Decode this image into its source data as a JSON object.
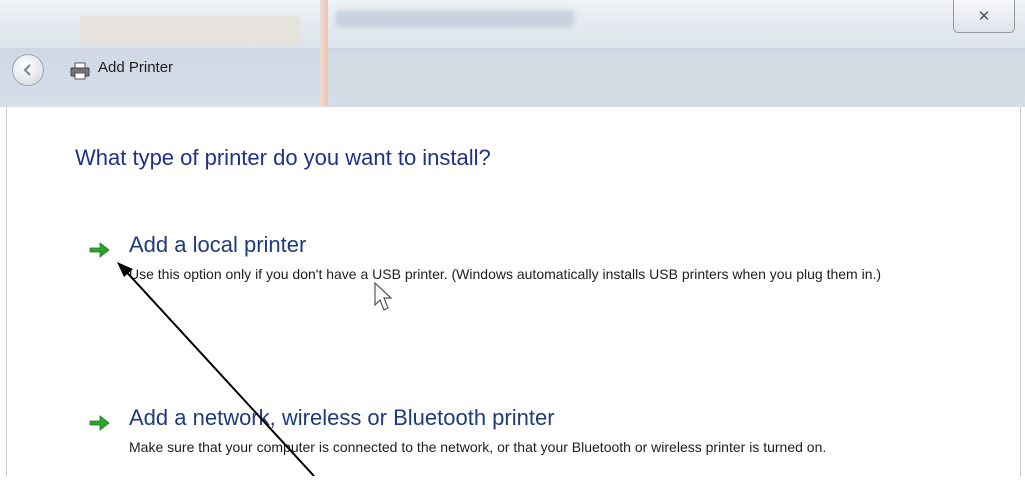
{
  "window": {
    "title": "Add Printer",
    "close_glyph": "✕"
  },
  "page": {
    "heading": "What type of printer do you want to install?"
  },
  "options": [
    {
      "title": "Add a local printer",
      "description": "Use this option only if you don't have a USB printer. (Windows automatically installs USB printers when you plug them in.)",
      "icon": "green-arrow-icon"
    },
    {
      "title": "Add a network, wireless or Bluetooth printer",
      "description": "Make sure that your computer is connected to the network, or that your Bluetooth or wireless printer is turned on.",
      "icon": "green-arrow-icon"
    }
  ],
  "colors": {
    "heading": "#1e3287",
    "option_title": "#1f3b7a",
    "arrow": "#2ca52c"
  }
}
